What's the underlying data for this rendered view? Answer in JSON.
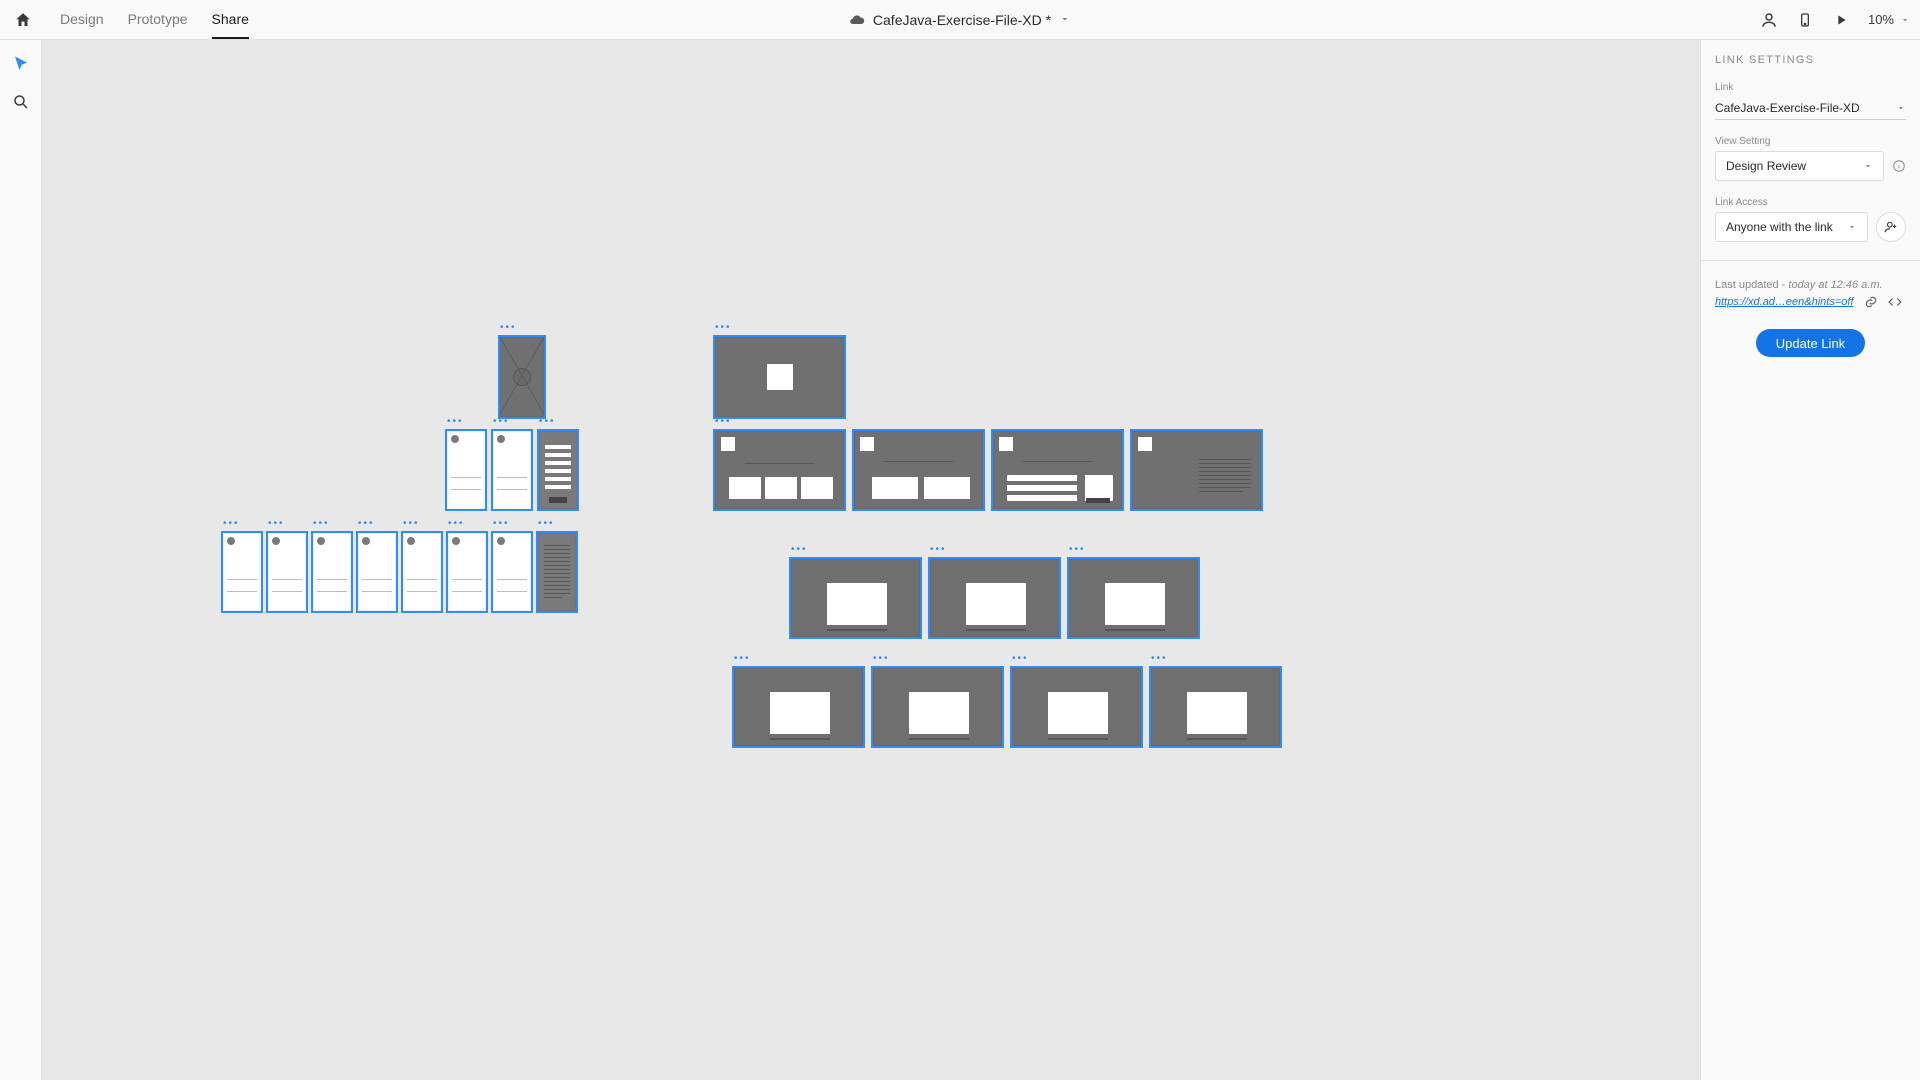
{
  "topbar": {
    "tabs": {
      "design": "Design",
      "prototype": "Prototype",
      "share": "Share"
    },
    "document_title": "CafeJava-Exercise-File-XD *",
    "zoom": "10%"
  },
  "panel": {
    "heading": "LINK SETTINGS",
    "link_label": "Link",
    "link_value": "CafeJava-Exercise-File-XD",
    "view_setting_label": "View Setting",
    "view_setting_value": "Design Review",
    "link_access_label": "Link Access",
    "link_access_value": "Anyone with the link",
    "last_updated_prefix": "Last updated - ",
    "last_updated_value": "today at 12:46 a.m.",
    "share_url": "https://xd.ad…een&hints=off",
    "update_button": "Update Link"
  }
}
